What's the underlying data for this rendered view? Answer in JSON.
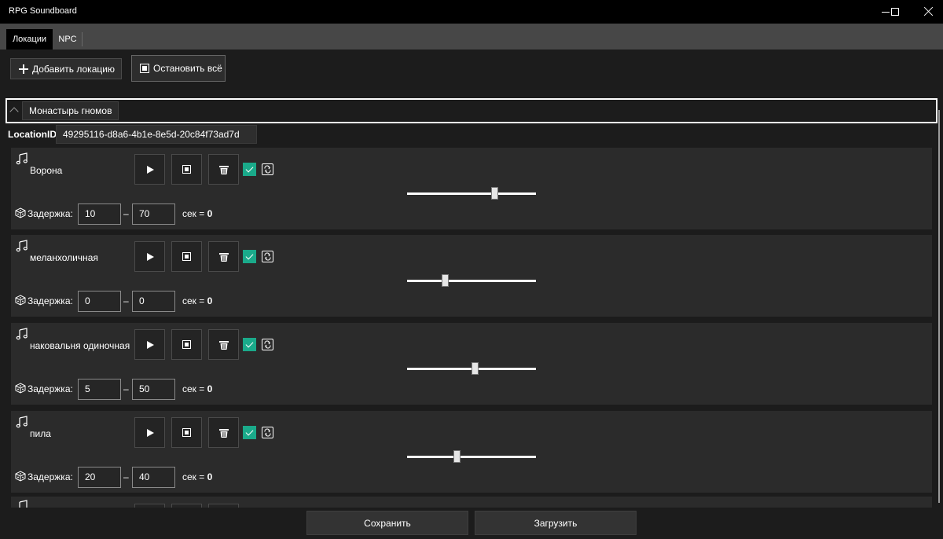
{
  "window": {
    "title": "RPG Soundboard"
  },
  "tabs": [
    {
      "label": "Локации",
      "active": true
    },
    {
      "label": "NPC",
      "active": false
    }
  ],
  "toolbar": {
    "add_location_label": "Добавить локацию",
    "stop_all_label": "Остановить всё"
  },
  "location": {
    "name": "Монастырь гномов",
    "id_label": "LocationID",
    "id_value": "49295116-d8a6-4b1e-8e5d-20c84f73ad7d"
  },
  "sounds": [
    {
      "name": "Ворона",
      "delay_label": "Задержка:",
      "delay_min": "10",
      "delay_max": "70",
      "sec_prefix": "сек =",
      "sec_total": "0",
      "loop_enabled": true,
      "volume": 0.68
    },
    {
      "name": "меланхоличная",
      "delay_label": "Задержка:",
      "delay_min": "0",
      "delay_max": "0",
      "sec_prefix": "сек =",
      "sec_total": "0",
      "loop_enabled": true,
      "volume": 0.3
    },
    {
      "name": "наковальня одиночная",
      "delay_label": "Задержка:",
      "delay_min": "5",
      "delay_max": "50",
      "sec_prefix": "сек =",
      "sec_total": "0",
      "loop_enabled": true,
      "volume": 0.53
    },
    {
      "name": "пила",
      "delay_label": "Задержка:",
      "delay_min": "20",
      "delay_max": "40",
      "sec_prefix": "сек =",
      "sec_total": "0",
      "loop_enabled": true,
      "volume": 0.39
    }
  ],
  "dash": "–",
  "footer": {
    "save_label": "Сохранить",
    "load_label": "Загрузить"
  },
  "colors": {
    "accent_check": "#1aaa8a",
    "background": "#1c1c1c",
    "card": "#2b2b2b"
  }
}
